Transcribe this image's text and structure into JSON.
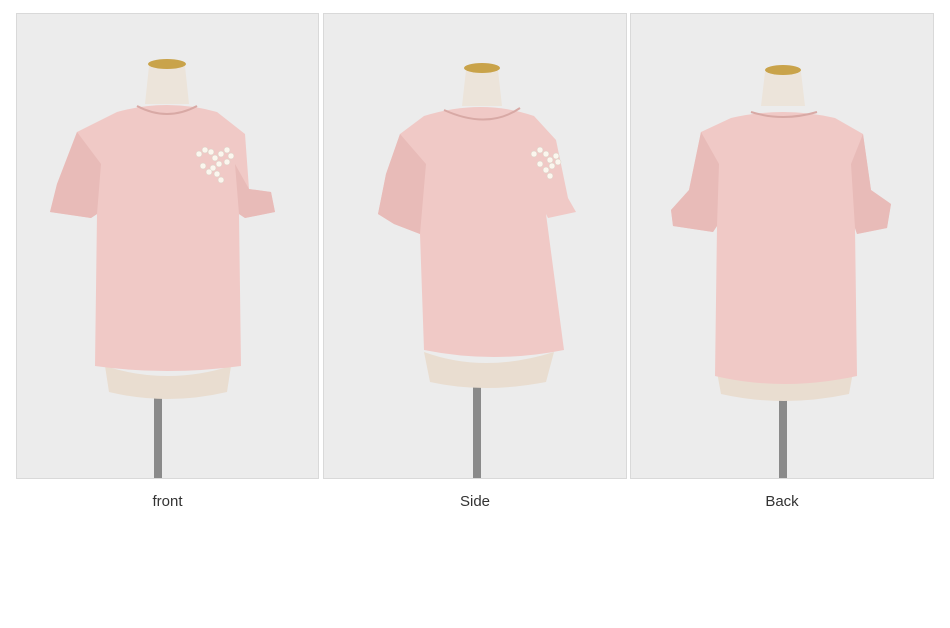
{
  "views": [
    {
      "caption": "front"
    },
    {
      "caption": "Side"
    },
    {
      "caption": "Back"
    }
  ],
  "colors": {
    "background": "#ececec",
    "shirt": "#f0c9c6",
    "shirt_shadow": "#e2b4b1",
    "mannequin": "#e9ddd0",
    "pole": "#8a8a8a",
    "neck_cap": "#c9a34a"
  }
}
